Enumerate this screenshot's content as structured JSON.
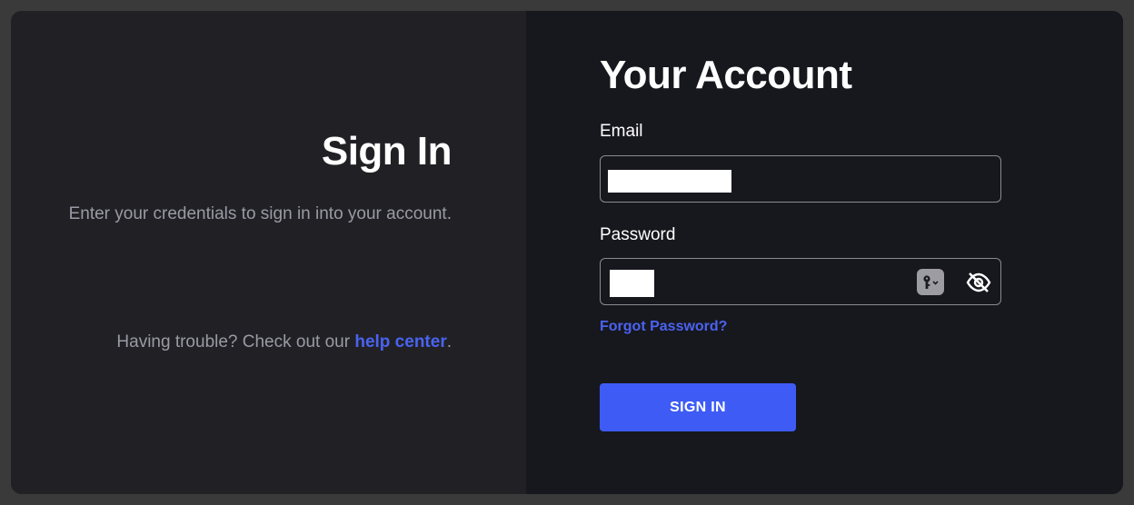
{
  "left": {
    "heading": "Sign In",
    "subtitle": "Enter your credentials to sign in into your account.",
    "trouble_prefix": "Having trouble? Check out our ",
    "help_link": "help center",
    "trouble_suffix": "."
  },
  "right": {
    "heading": "Your Account",
    "email": {
      "label": "Email",
      "value": ""
    },
    "password": {
      "label": "Password",
      "value": ""
    },
    "forgot_link": "Forgot Password?",
    "submit_label": "SIGN IN"
  },
  "icons": {
    "password_manager": "key-icon",
    "toggle_visibility": "eye-off-icon"
  },
  "colors": {
    "accent": "#3e5cf5",
    "link": "#4a63f0",
    "left_bg": "#212125",
    "right_bg": "#17171e"
  }
}
